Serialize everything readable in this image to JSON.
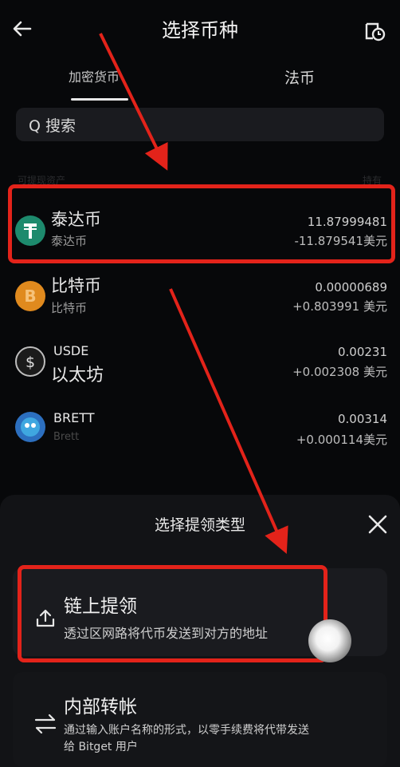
{
  "header": {
    "title": "选择币种"
  },
  "tabs": [
    {
      "label": "加密货币",
      "active": true
    },
    {
      "label": "法币",
      "active": false
    }
  ],
  "search": {
    "label": "Q 搜索"
  },
  "list_header": {
    "left": "可提现资产",
    "right": "持有"
  },
  "assets": [
    {
      "name": "泰达币",
      "sub": "泰达币",
      "amount": "11.87999481",
      "value": "-11.879541美元",
      "icon_color": "#1d8a6d",
      "icon": "tether-icon"
    },
    {
      "name": "比特币",
      "sub": "比特币",
      "amount": "0.00000689",
      "value": "+0.803991 美元",
      "icon_color": "#e08a1e",
      "icon": "bitcoin-icon"
    },
    {
      "name": "USDE",
      "sub": "以太坊",
      "amount": "0.00231",
      "value": "+0.002308 美元",
      "icon_color": "#1b1b1b",
      "icon": "usde-icon"
    },
    {
      "name": "BRETT",
      "sub": "Brett",
      "amount": "0.00314",
      "value": "+0.000114美元",
      "icon_color": "#2c6fbf",
      "icon": "brett-icon"
    }
  ],
  "sheet": {
    "title": "选择提领类型",
    "options": [
      {
        "title": "链上提领",
        "desc": "透过区网路将代币发送到对方的地址",
        "icon": "upload-icon"
      },
      {
        "title": "内部转帐",
        "desc_line1": "通过输入账户名称的形式，以零手续费将代带发送",
        "desc_line2": "给 Bitget 用户",
        "icon": "transfer-icon"
      }
    ]
  },
  "colors": {
    "annotation_red": "#e3231a",
    "background": "#07080a",
    "sheet_bg": "#121316"
  }
}
